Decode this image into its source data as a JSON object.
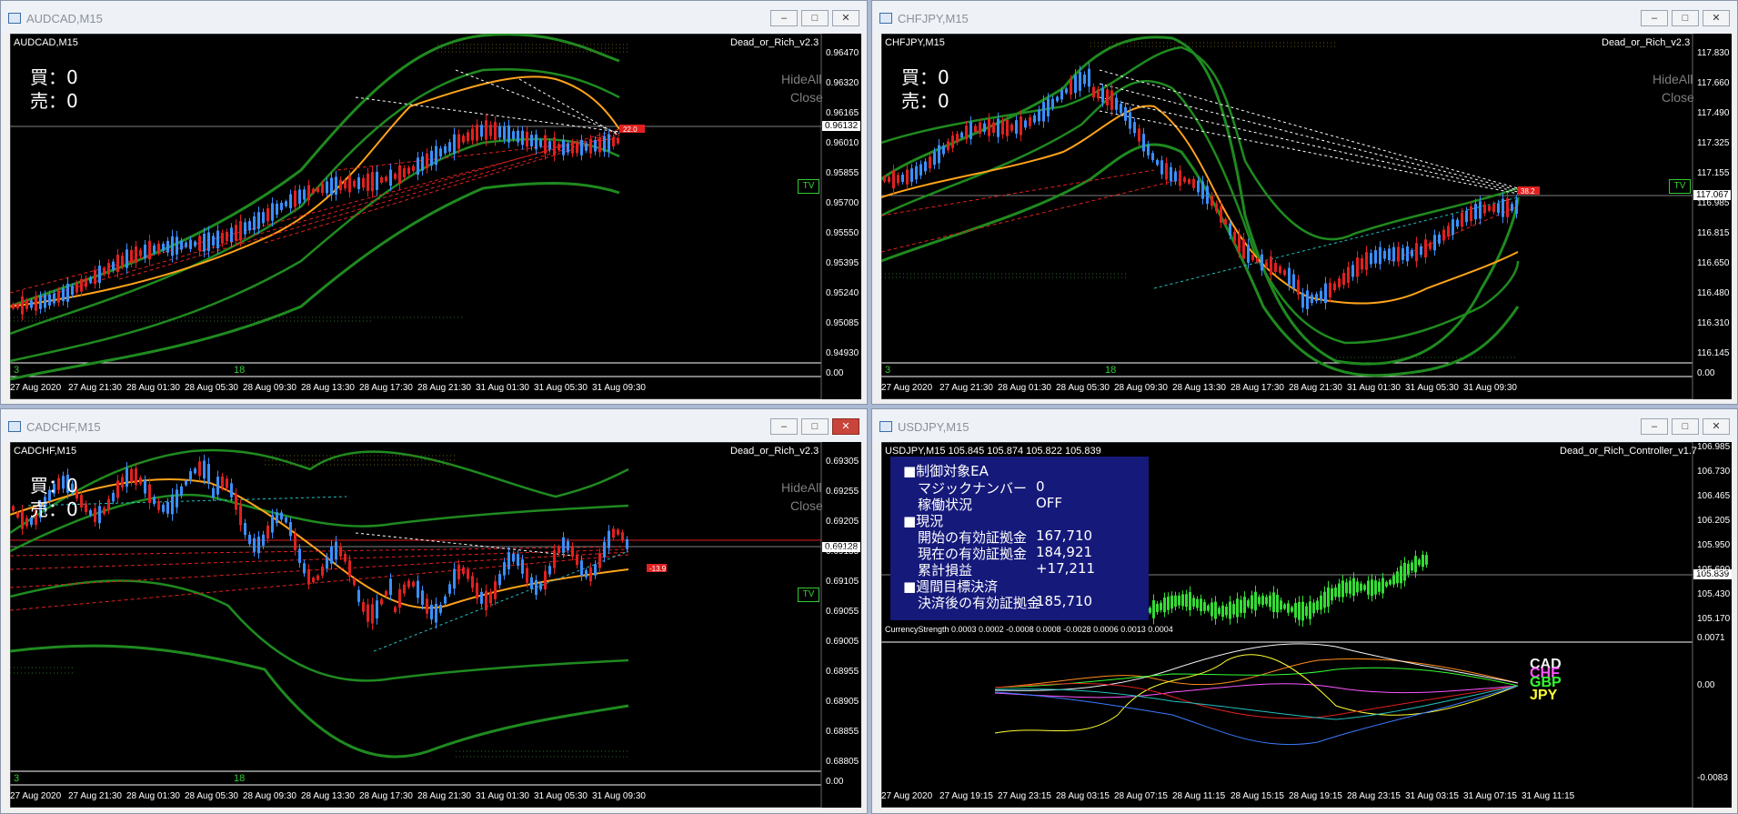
{
  "windows": [
    {
      "title": "AUDCAD,M15",
      "chart_label": "AUDCAD,M15",
      "indicator": "Dead_or_Rich_v2.3",
      "buy": "買：0",
      "sell": "売：0",
      "hide_all": "HideAll",
      "close": "Close",
      "tv": "TV",
      "current_price": "0.96132",
      "y_ticks": [
        "0.96470",
        "0.96320",
        "0.96165",
        "0.96010",
        "0.95855",
        "0.95700",
        "0.95550",
        "0.95395",
        "0.95240",
        "0.95085",
        "0.94930",
        "0.00"
      ],
      "x_ticks": [
        "27 Aug 2020",
        "27 Aug 21:30",
        "28 Aug 01:30",
        "28 Aug 05:30",
        "28 Aug 09:30",
        "28 Aug 13:30",
        "28 Aug 17:30",
        "28 Aug 21:30",
        "31 Aug 01:30",
        "31 Aug 05:30",
        "31 Aug 09:30"
      ],
      "sub_left": "3",
      "sub_mid": "18"
    },
    {
      "title": "CHFJPY,M15",
      "chart_label": "CHFJPY,M15",
      "indicator": "Dead_or_Rich_v2.3",
      "buy": "買：0",
      "sell": "売：0",
      "hide_all": "HideAll",
      "close": "Close",
      "tv": "TV",
      "current_price": "117.067",
      "y_ticks": [
        "117.830",
        "117.660",
        "117.490",
        "117.325",
        "117.155",
        "116.985",
        "116.815",
        "116.650",
        "116.480",
        "116.310",
        "116.145",
        "0.00"
      ],
      "x_ticks": [
        "27 Aug 2020",
        "27 Aug 21:30",
        "28 Aug 01:30",
        "28 Aug 05:30",
        "28 Aug 09:30",
        "28 Aug 13:30",
        "28 Aug 17:30",
        "28 Aug 21:30",
        "31 Aug 01:30",
        "31 Aug 05:30",
        "31 Aug 09:30"
      ],
      "sub_left": "3",
      "sub_mid": "18"
    },
    {
      "title": "CADCHF,M15",
      "chart_label": "CADCHF,M15",
      "indicator": "Dead_or_Rich_v2.3",
      "buy": "買：0",
      "sell": "売：0",
      "hide_all": "HideAll",
      "close": "Close",
      "tv": "TV",
      "current_price": "0.69128",
      "y_ticks": [
        "0.69305",
        "0.69255",
        "0.69205",
        "0.69155",
        "0.69105",
        "0.69055",
        "0.69005",
        "0.68955",
        "0.68905",
        "0.68855",
        "0.68805",
        "0.00"
      ],
      "x_ticks": [
        "27 Aug 2020",
        "27 Aug 21:30",
        "28 Aug 01:30",
        "28 Aug 05:30",
        "28 Aug 09:30",
        "28 Aug 13:30",
        "28 Aug 17:30",
        "28 Aug 21:30",
        "31 Aug 01:30",
        "31 Aug 05:30",
        "31 Aug 09:30"
      ],
      "sub_left": "3",
      "sub_mid": "18"
    },
    {
      "title": "USDJPY,M15",
      "chart_label": "USDJPY,M15  105.845 105.874 105.822 105.839",
      "indicator": "Dead_or_Rich_Controller_v1.7",
      "current_price": "105.839",
      "y_ticks": [
        "106.985",
        "106.730",
        "106.465",
        "106.205",
        "105.950",
        "105.690",
        "105.430",
        "105.170"
      ],
      "cs_label": "CurrencyStrength 0.0003 0.0002 -0.0008 0.0008 -0.0028 0.0006 0.0013 0.0004",
      "cs_ticks": [
        "0.0071",
        "0.00",
        "-0.0083"
      ],
      "cs_legend": [
        {
          "name": "CAD",
          "color": "#f2f2f2"
        },
        {
          "name": "CHF",
          "color": "#ff55ff"
        },
        {
          "name": "GBP",
          "color": "#33ff33"
        },
        {
          "name": "JPY",
          "color": "#ffff33"
        }
      ],
      "x_ticks": [
        "27 Aug 2020",
        "27 Aug 19:15",
        "27 Aug 23:15",
        "28 Aug 03:15",
        "28 Aug 07:15",
        "28 Aug 11:15",
        "28 Aug 15:15",
        "28 Aug 19:15",
        "28 Aug 23:15",
        "31 Aug 03:15",
        "31 Aug 07:15",
        "31 Aug 11:15"
      ],
      "panel": {
        "h1": "■制御対象EA",
        "magic_label": "マジックナンバー",
        "magic_value": "0",
        "status_label": "稼働状況",
        "status_value": "OFF",
        "h2": "■現況",
        "start_label": "開始の有効証拠金",
        "start_value": "167,710",
        "now_label": "現在の有効証拠金",
        "now_value": "184,921",
        "pnl_label": "累計損益",
        "pnl_value": "+17,211",
        "h3": "■週間目標決済",
        "after_label": "決済後の有効証拠金",
        "after_value": "185,710"
      }
    }
  ],
  "window_buttons": {
    "minimize": "‒",
    "maximize": "□",
    "close": "✕"
  }
}
